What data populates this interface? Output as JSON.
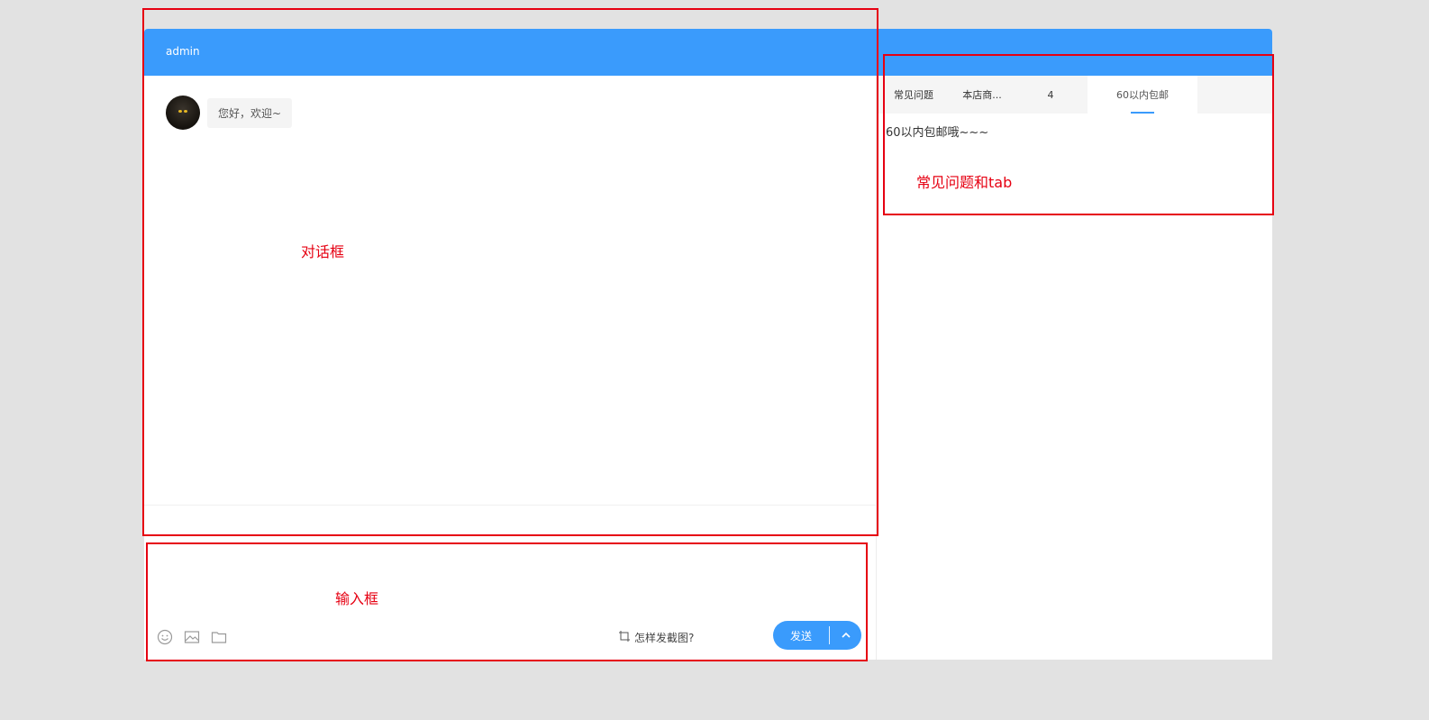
{
  "window": {
    "title": "admin"
  },
  "chat": {
    "messages": [
      {
        "avatar": "cat-avatar",
        "text": "您好，欢迎~"
      }
    ]
  },
  "input": {
    "value": "",
    "placeholder": "",
    "icons": [
      "smile-icon",
      "image-icon",
      "folder-icon"
    ],
    "screenshot_hint": "怎样发截图?",
    "send_label": "发送",
    "send_more_icon": "chevron-up-icon"
  },
  "faq": {
    "tabs": [
      {
        "label": "常见问题",
        "active": false
      },
      {
        "label": "本店商...",
        "active": false
      },
      {
        "label": "4",
        "active": false
      },
      {
        "label": "60以内包邮",
        "active": true
      }
    ],
    "content": "60以内包邮哦~~~"
  },
  "annotations": {
    "dialog_label": "对话框",
    "input_label": "输入框",
    "faq_label": "常见问题和tab"
  },
  "colors": {
    "primary": "#3a9bfc",
    "annotation": "#e60012",
    "background": "#e2e2e2"
  }
}
